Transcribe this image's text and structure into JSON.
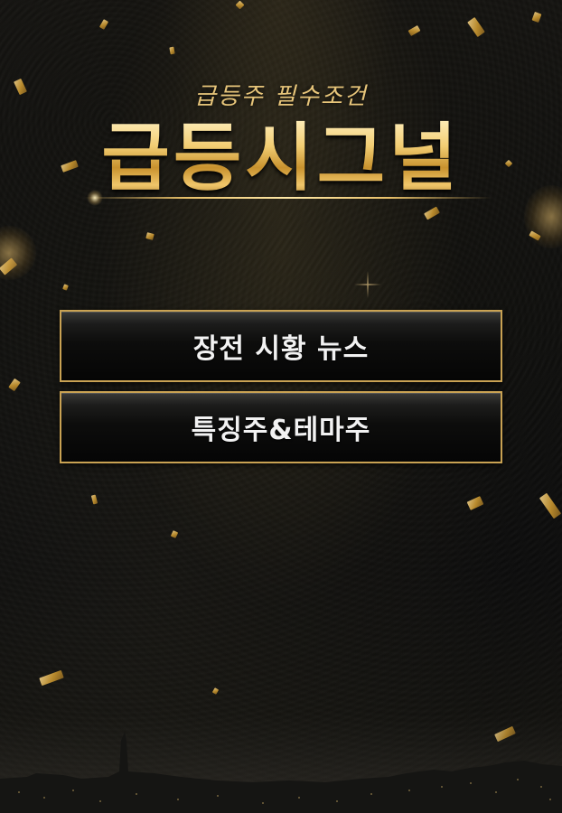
{
  "header": {
    "subtitle": "급등주 필수조건",
    "title": "급등시그널"
  },
  "menu": {
    "items": [
      {
        "label": "장전 시황 뉴스"
      },
      {
        "label": "특징주&테마주"
      }
    ]
  },
  "colors": {
    "accent_gold": "#c9a253",
    "title_gold": "#f2cd73",
    "button_text": "#f2f2f2",
    "background": "#0c0c0c"
  },
  "decorations": {
    "background_image": "leather-texture-with-gold-confetti-and-night-city-skyline"
  }
}
